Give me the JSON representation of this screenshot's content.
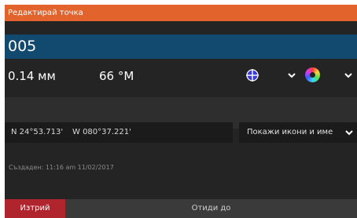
{
  "dialog": {
    "title": "Редактирай точка",
    "name_value": "005",
    "distance": "0.14 мм",
    "bearing": "66 °М",
    "symbol_icon": "crosshair-target-icon",
    "color_icon": "color-wheel-icon",
    "latitude": "N 24°53.713'",
    "longitude": "W 080°37.221'",
    "display_mode": "Покажи икони и име",
    "created": "Създаден: 11:16 am  11/02/2017",
    "delete_label": "Изтрий",
    "goto_label": "Отиди до"
  },
  "colors": {
    "titlebar": "#e2632b",
    "name_field": "#12496e",
    "delete": "#b0252d",
    "background": "#242424"
  }
}
